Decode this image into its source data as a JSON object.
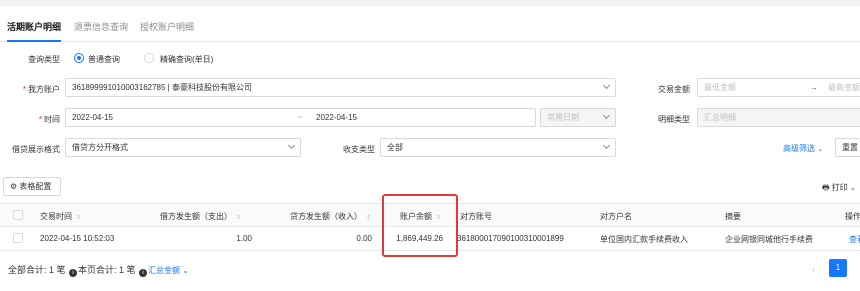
{
  "tabs": [
    {
      "label": "活期账户明细"
    },
    {
      "label": "退票信息查询"
    },
    {
      "label": "授权账户明细"
    }
  ],
  "form": {
    "query_type_label": "查询类型",
    "query_options": [
      "普通查询",
      "精确查询(单日)"
    ],
    "account_label": "我方账户",
    "account_value": "3618999910100031627​85 | 泰豪科技股份有限公司",
    "amount_label": "交易金额",
    "amount_min_placeholder": "最低金额",
    "amount_arrow": "→",
    "amount_max_placeholder": "最高金额",
    "time_label": "时间",
    "date_start": "2022-04-15",
    "date_sep": "~",
    "date_end": "2022-04-15",
    "common_date_placeholder": "常用日期",
    "detail_type_label": "明细类型",
    "detail_type_placeholder": "汇总明细",
    "format_label": "借贷展示格式",
    "format_value": "借贷方分开格式",
    "inout_label": "收支类型",
    "inout_value": "全部",
    "advanced_filter": "高级筛选",
    "reset_button": "重置"
  },
  "toolbar": {
    "table_config": "表格配置",
    "print": "打印"
  },
  "table": {
    "headers": [
      "交易时间",
      "借方发生额（支出）",
      "贷方发生额（收入）",
      "账户余额",
      "对方账号",
      "对方户名",
      "摘要",
      "操作"
    ],
    "rows": [
      {
        "time": "2022-04-15 10:52:03",
        "debit": "1.00",
        "credit": "0.00",
        "balance": "1,869,449.26",
        "counter_account": "3618000170901003100018​99",
        "counter_name": "单位国内汇款手续费收入",
        "summary": "企业网银同城他行手续费",
        "action": "查看"
      }
    ]
  },
  "footer": {
    "total_label": "全部合计: 1 笔",
    "page_total_label": "本页合计: 1 笔",
    "summary_link": "汇总金额",
    "current_page": "1"
  },
  "colors": {
    "primary": "#1677ff",
    "highlight": "#e53935"
  }
}
